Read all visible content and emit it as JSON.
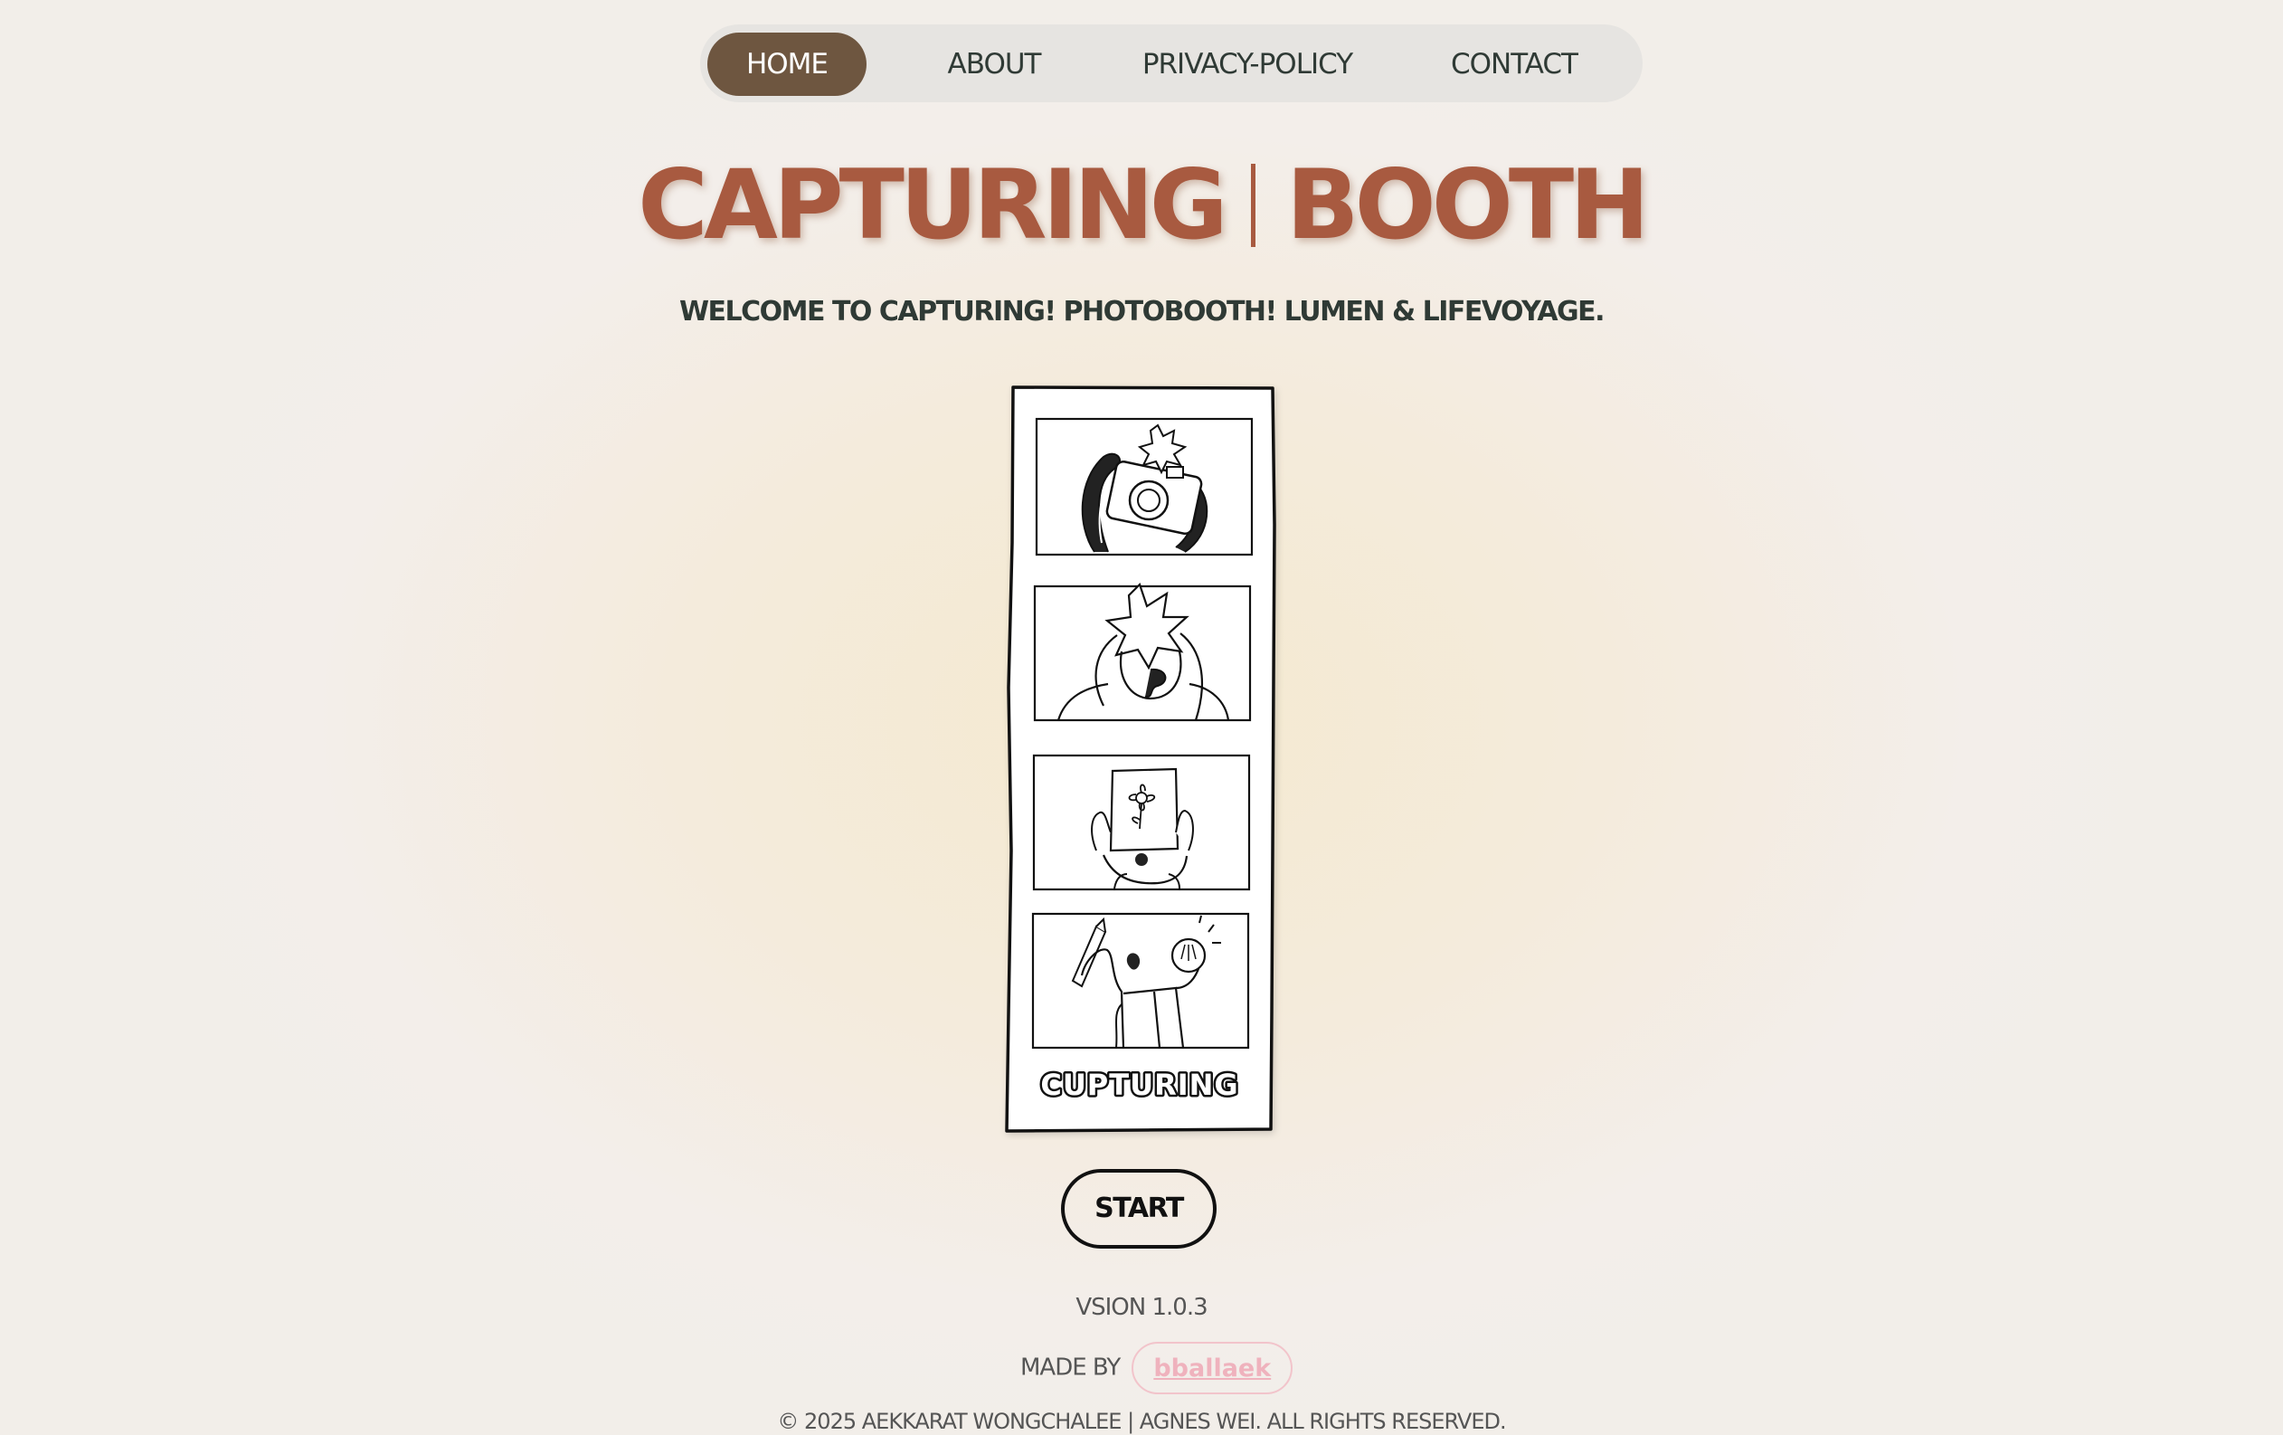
{
  "nav": {
    "items": [
      {
        "label": "HOME",
        "active": true
      },
      {
        "label": "ABOUT",
        "active": false
      },
      {
        "label": "PRIVACY-POLICY",
        "active": false
      },
      {
        "label": "CONTACT",
        "active": false
      }
    ]
  },
  "hero": {
    "title_left": "CAPTURING",
    "title_right": "BOOTH",
    "subtitle": "WELCOME TO CAPTURING! PHOTOBOOTH! LUMEN & LIFEVOYAGE."
  },
  "photo_strip": {
    "caption": "CUPTURING"
  },
  "start_label": "START",
  "footer": {
    "version": "VSION 1.0.3",
    "made_by_label": "MADE BY",
    "made_by_handle": "bballaek",
    "copyright": "© 2025 AEKKARAT WONGCHALEE | AGNES WEI. ALL RIGHTS RESERVED."
  },
  "colors": {
    "title": "#a85a40",
    "nav_active": "#6e5640",
    "handle_pink": "#efb2bd"
  }
}
